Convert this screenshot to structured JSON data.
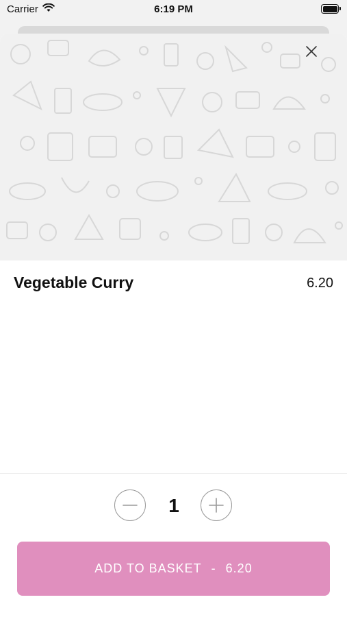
{
  "status_bar": {
    "carrier": "Carrier",
    "time": "6:19 PM"
  },
  "item": {
    "name": "Vegetable Curry",
    "price": "6.20"
  },
  "quantity": {
    "value": "1"
  },
  "add_button": {
    "label": "ADD TO BASKET",
    "separator": "-",
    "price": "6.20"
  },
  "colors": {
    "accent": "#e08fbe",
    "hero_background": "#f1f1f1"
  },
  "icons": {
    "close": "close-icon",
    "minus": "minus-icon",
    "plus": "plus-icon",
    "wifi": "wifi-icon",
    "battery": "battery-icon"
  }
}
